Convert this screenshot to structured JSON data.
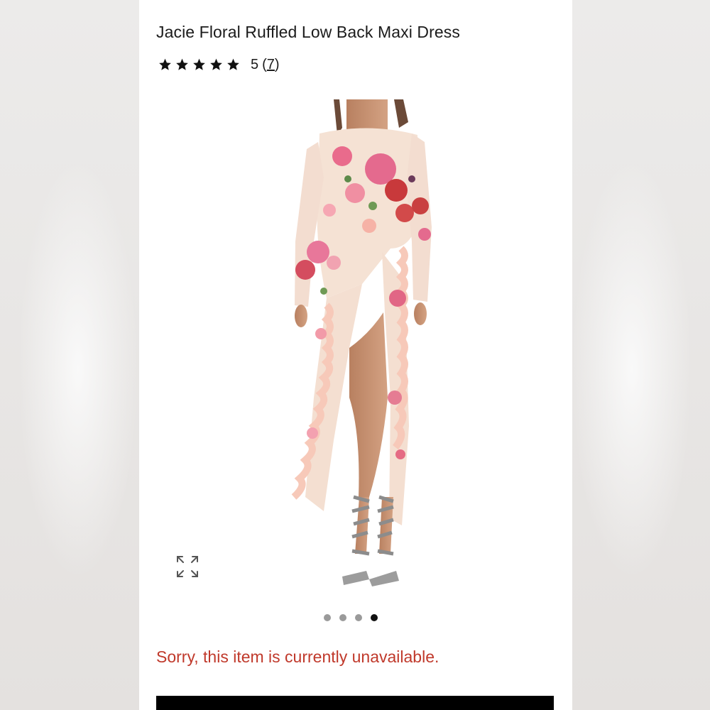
{
  "product": {
    "title": "Jacie Floral Ruffled Low Back Maxi Dress",
    "rating": {
      "stars": 5,
      "value": "5",
      "count_prefix": "(",
      "count": "7",
      "count_suffix": ")"
    }
  },
  "gallery": {
    "expand_icon": "expand-icon",
    "dots_total": 4,
    "active_dot": 4,
    "image_description_icon": "product-photo"
  },
  "availability": {
    "message": "Sorry, this item is currently unavailable."
  },
  "colors": {
    "text": "#1b1b1b",
    "error": "#c0392b",
    "dot_inactive": "#9a9a9a",
    "dot_active": "#111111",
    "dress_base": "#f6e3d6",
    "rose_pink": "#e9678a",
    "rose_red": "#c63a3a"
  }
}
